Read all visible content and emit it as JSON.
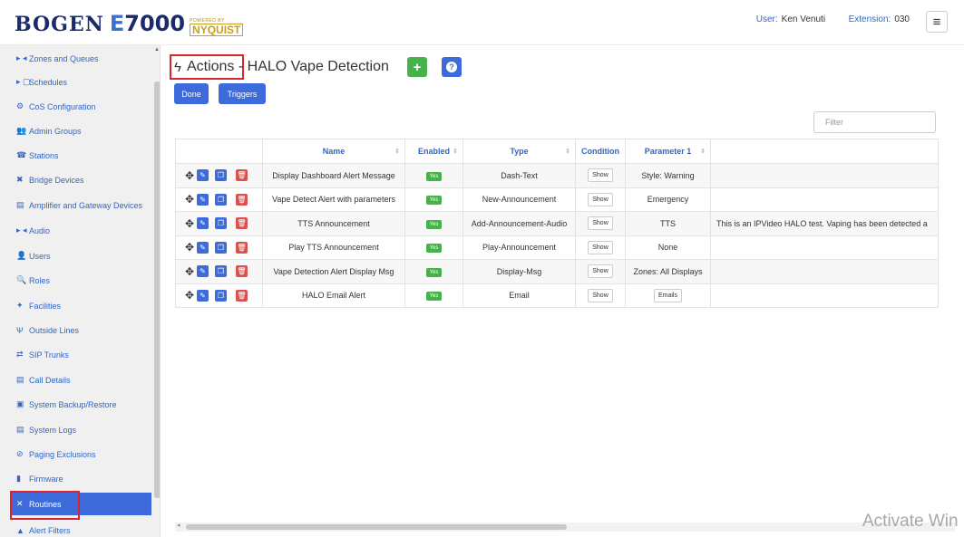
{
  "header": {
    "logo_brand": "BOGEN",
    "logo_model_first": "E",
    "logo_model_rest": "7000",
    "logo_powered_by": "POWERED BY",
    "logo_partner": "NYQUIST",
    "user_label": "User:",
    "user_name": "Ken Venuti",
    "extension_label": "Extension:",
    "extension_value": "030",
    "menu_icon": "≡"
  },
  "sidebar": {
    "items": [
      {
        "label": "Zones and Queues",
        "icon": "▸ ◂"
      },
      {
        "label": "Schedules",
        "icon": "▸ ▢"
      },
      {
        "label": "CoS Configuration",
        "icon": "⚙"
      },
      {
        "label": "Admin Groups",
        "icon": "👥"
      },
      {
        "label": "Stations",
        "icon": "☎"
      },
      {
        "label": "Bridge Devices",
        "icon": "✖"
      },
      {
        "label": "Amplifier and Gateway Devices",
        "icon": "▤"
      },
      {
        "label": "Audio",
        "icon": "▸ ◂"
      },
      {
        "label": "Users",
        "icon": "👤"
      },
      {
        "label": "Roles",
        "icon": "🔍"
      },
      {
        "label": "Facilities",
        "icon": "✦"
      },
      {
        "label": "Outside Lines",
        "icon": "Ψ"
      },
      {
        "label": "SIP Trunks",
        "icon": "⇄"
      },
      {
        "label": "Call Details",
        "icon": "▤"
      },
      {
        "label": "System Backup/Restore",
        "icon": "▣"
      },
      {
        "label": "System Logs",
        "icon": "▤"
      },
      {
        "label": "Paging Exclusions",
        "icon": "⊘"
      },
      {
        "label": "Firmware",
        "icon": "▮"
      },
      {
        "label": "Routines",
        "icon": "✕"
      },
      {
        "label": "Alert Filters",
        "icon": "▲"
      }
    ]
  },
  "page": {
    "title_prefix": "Actions",
    "title_suffix": " - HALO Vape Detection",
    "add_icon": "+",
    "help_icon": "?",
    "done_label": "Done",
    "triggers_label": "Triggers",
    "filter_placeholder": "Filter"
  },
  "table": {
    "headers": [
      "",
      "Name",
      "Enabled",
      "Type",
      "Condition",
      "Parameter 1",
      ""
    ],
    "rows": [
      {
        "name": "Display Dashboard Alert Message",
        "enabled": "Yes",
        "type": "Dash-Text",
        "condition": "Show",
        "param1": "Style: Warning",
        "param2": ""
      },
      {
        "name": "Vape Detect Alert with parameters",
        "enabled": "Yes",
        "type": "New-Announcement",
        "condition": "Show",
        "param1": "Emergency",
        "param2": ""
      },
      {
        "name": "TTS Announcement",
        "enabled": "Yes",
        "type": "Add-Announcement-Audio",
        "condition": "Show",
        "param1": "TTS",
        "param2": "This is an IPVideo HALO test. Vaping has been detected a"
      },
      {
        "name": "Play TTS Announcement",
        "enabled": "Yes",
        "type": "Play-Announcement",
        "condition": "Show",
        "param1": "None",
        "param2": ""
      },
      {
        "name": "Vape Detection Alert Display Msg",
        "enabled": "Yes",
        "type": "Display-Msg",
        "condition": "Show",
        "param1": "Zones: All Displays",
        "param2": ""
      },
      {
        "name": "HALO Email Alert",
        "enabled": "Yes",
        "type": "Email",
        "condition": "Show",
        "param1": "Emails",
        "param2": ""
      }
    ]
  },
  "watermark": "Activate Win"
}
